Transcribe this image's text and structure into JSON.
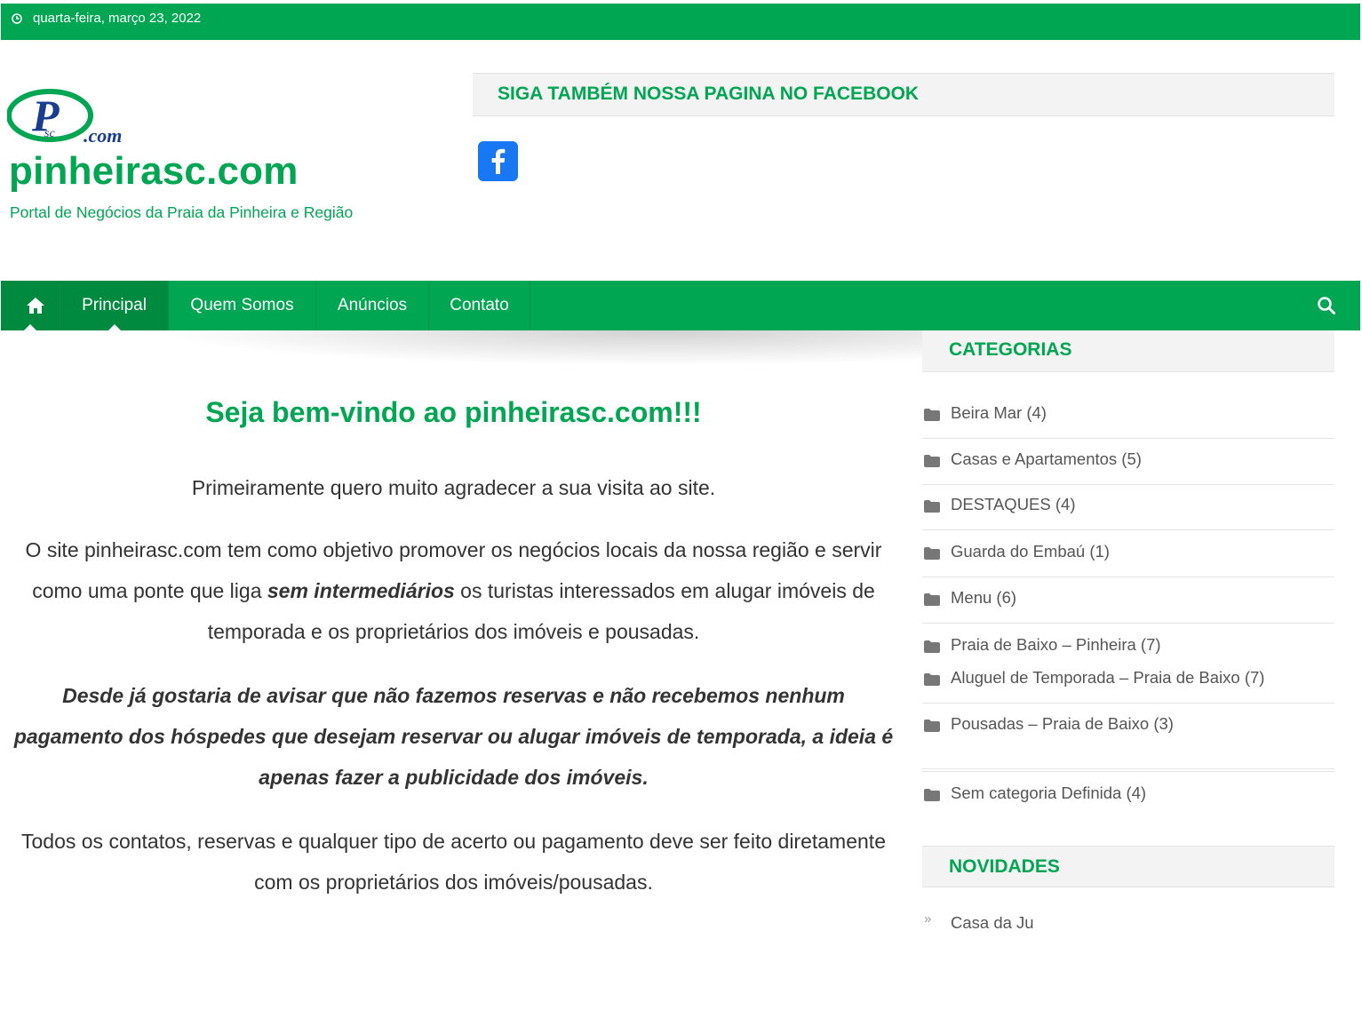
{
  "topbar": {
    "date": "quarta-feira, março 23, 2022",
    "icon": "clock-icon"
  },
  "header": {
    "logo_text_main": "P",
    "logo_text_sub": "sc",
    "logo_text_com": ".com",
    "site_title": "pinheirasc.com",
    "tagline": "Portal de Negócios da Praia da Pinheira e Região",
    "facebook_widget_title": "SIGA TAMBÉM NOSSA PAGINA NO FACEBOOK"
  },
  "nav": {
    "items": [
      {
        "label": "Principal",
        "active": true
      },
      {
        "label": "Quem Somos",
        "active": false
      },
      {
        "label": "Anúncios",
        "active": false
      },
      {
        "label": "Contato",
        "active": false
      }
    ]
  },
  "main": {
    "heading": "Seja bem-vindo ao pinheirasc.com!!!",
    "p1": "Primeiramente quero muito agradecer a sua visita ao site.",
    "p2_before": "O site pinheirasc.com tem como objetivo promover os negócios locais da nossa região e servir como uma ponte que liga ",
    "p2_bold": "sem intermediários",
    "p2_after": " os turistas interessados em alugar imóveis de temporada e os proprietários dos imóveis e pousadas.",
    "p3": "Desde já gostaria de avisar que não fazemos reservas e não recebemos nenhum pagamento dos hóspedes que desejam reservar ou alugar imóveis de temporada, a ideia é apenas fazer a publicidade dos imóveis.",
    "p4": "Todos os contatos, reservas e qualquer tipo de acerto ou pagamento deve ser feito diretamente com os proprietários dos imóveis/pousadas."
  },
  "sidebar": {
    "categories_title": "CATEGORIAS",
    "categories": [
      {
        "label": "Beira Mar",
        "count": "(4)"
      },
      {
        "label": "Casas e Apartamentos",
        "count": "(5)"
      },
      {
        "label": "DESTAQUES",
        "count": "(4)"
      },
      {
        "label": "Guarda do Embaú",
        "count": "(1)"
      },
      {
        "label": "Menu",
        "count": "(6)"
      },
      {
        "label": "Praia de Baixo – Pinheira",
        "count": "(7)"
      },
      {
        "label": "Aluguel de Temporada – Praia de Baixo",
        "count": "(7)"
      },
      {
        "label": "Pousadas – Praia de Baixo",
        "count": "(3)"
      },
      {
        "label": "Sem categoria Definida",
        "count": "(4)"
      }
    ],
    "news_title": "NOVIDADES",
    "news_items": [
      "Casa da Ju"
    ]
  },
  "colors": {
    "brand_green": "#00a651",
    "nav_active": "#008a40",
    "facebook_blue": "#1877f2"
  }
}
